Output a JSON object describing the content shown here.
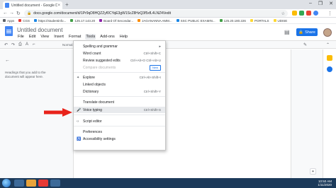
{
  "browser": {
    "tab_title": "Untitled document - Google Do...",
    "tab_close": "×",
    "new_tab": "+",
    "window_controls": [
      "–",
      "❐",
      "✕"
    ],
    "url": "docs.google.com/document/d/1Pr9qD8HQZZyf0CYqE3gW1ScZ8HzQ3f5xfL4LNZ4Vedit",
    "bookmarks": [
      {
        "label": "Apps",
        "color": "#5f6368"
      },
      {
        "label": "CGS",
        "color": "#e53935"
      },
      {
        "label": "https://studentinfo...",
        "color": "#1e88e5"
      },
      {
        "label": "125.17.143.20",
        "color": "#43a047"
      },
      {
        "label": "Board Of Secondar...",
        "color": "#8e24aa"
      },
      {
        "label": "JAGANANNA AMM...",
        "color": "#fb8c00"
      },
      {
        "label": "SSC PUBLIC EXAMIN...",
        "color": "#1e88e5"
      },
      {
        "label": "125.20.180.226",
        "color": "#43a047"
      },
      {
        "label": "PORTALS",
        "color": "#fdd835"
      },
      {
        "label": "UDISE",
        "color": "#fdd835"
      }
    ]
  },
  "docs": {
    "title": "Untitled document",
    "menu": [
      "File",
      "Edit",
      "View",
      "Insert",
      "Format",
      "Tools",
      "Add-ons",
      "Help"
    ],
    "active_menu": "Tools",
    "share_label": "Share",
    "toolbar_style": "Normal",
    "outline_placeholder": "Headings that you add to the document will appear here."
  },
  "tools_menu": {
    "items": [
      {
        "label": "Spelling and grammar",
        "shortcut": "",
        "icon": "",
        "submenu": true
      },
      {
        "label": "Word count",
        "shortcut": "Ctrl+Shift+C",
        "icon": ""
      },
      {
        "label": "Review suggested edits",
        "shortcut": "Ctrl+Alt+O Ctrl+Alt+U",
        "icon": ""
      },
      {
        "label": "Compare documents",
        "shortcut": "",
        "icon": "",
        "badge": "New",
        "disabled": true
      },
      {
        "label": "Explore",
        "shortcut": "Ctrl+Alt+Shift+I",
        "icon": "✦"
      },
      {
        "label": "Linked objects",
        "shortcut": "",
        "icon": ""
      },
      {
        "label": "Dictionary",
        "shortcut": "Ctrl+Shift+Y",
        "icon": ""
      },
      {
        "label": "Translate document",
        "shortcut": "",
        "icon": ""
      },
      {
        "label": "Voice typing",
        "shortcut": "Ctrl+Shift+S",
        "icon": "🎤",
        "highlighted": true
      },
      {
        "label": "Script editor",
        "shortcut": "",
        "icon": "‹›"
      },
      {
        "label": "Preferences",
        "shortcut": "",
        "icon": ""
      },
      {
        "label": "Accessibility settings",
        "shortcut": "",
        "icon": "♿"
      }
    ]
  },
  "taskbar": {
    "time": "10:50 AM",
    "date": "1/11/2020"
  },
  "colors": {
    "accent": "#1a73e8",
    "annotation_arrow": "#e8231b"
  }
}
